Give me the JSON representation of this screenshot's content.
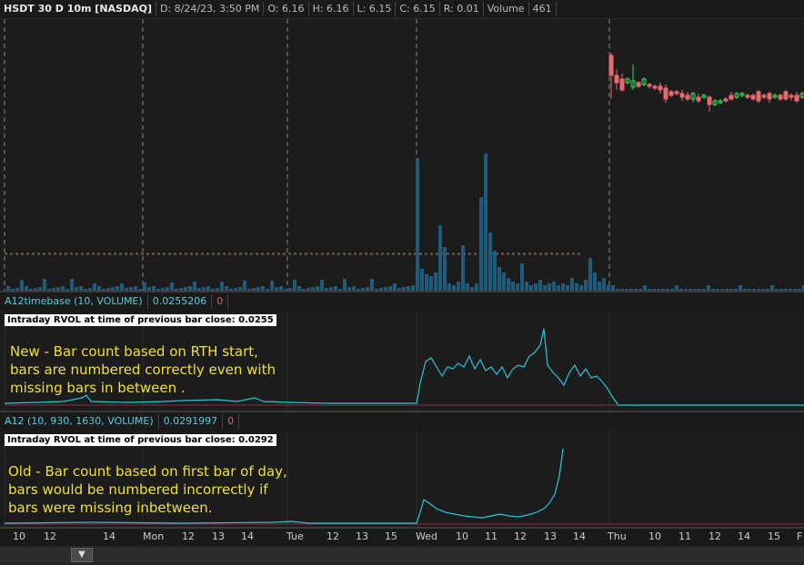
{
  "header": {
    "symbol": "HSDT 30 D 10m [NASDAQ]",
    "date": "D: 8/24/23, 3:50 PM",
    "open": "O: 6.16",
    "high": "H: 6.16",
    "low": "L: 6.15",
    "close": "C: 6.15",
    "range": "R: 0.01",
    "volume_label": "Volume",
    "volume_value": "461"
  },
  "study1": {
    "name": "A12timebase (10, VOLUME)",
    "value": "0.0255206",
    "value2": "0",
    "label": "Intraday RVOL at time of previous bar close: 0.0255",
    "note": "New - Bar count based on RTH start,\nbars are numbered correctly even with\nmissing bars in between ."
  },
  "study2": {
    "name": "A12 (10, 930, 1630, VOLUME)",
    "value": "0.0291997",
    "value2": "0",
    "label": "Intraday RVOL at time of previous bar close: 0.0292",
    "note": "Old - Bar count based on first bar of day,\nbars would be numbered incorrectly if\nbars were missing inbetween."
  },
  "xaxis": {
    "ticks": [
      "10",
      "12",
      "14",
      "Mon",
      "12",
      "13",
      "14",
      "Tue",
      "12",
      "13",
      "15",
      "Wed",
      "10",
      "11",
      "12",
      "13",
      "14",
      "Thu",
      "10",
      "11",
      "12",
      "14",
      "15",
      "F"
    ]
  },
  "scrollbar": {
    "thumb_glyph": "▼"
  },
  "colors": {
    "cyan": "#26c6da",
    "volume": "#1f5b7a",
    "up": "#3ad45a",
    "down": "#e86a70",
    "divider": "#888888"
  }
}
